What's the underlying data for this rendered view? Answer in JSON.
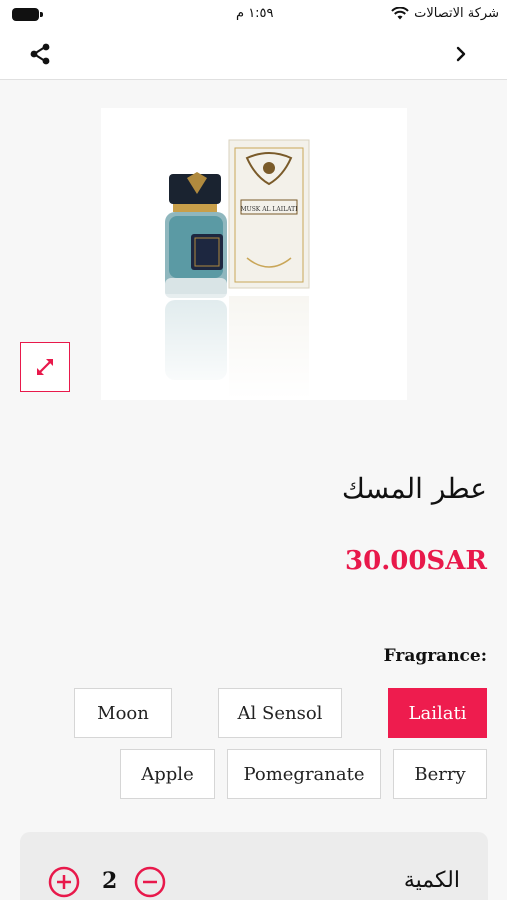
{
  "status_bar": {
    "carrier": "شركة الاتصالات",
    "time": "١:٥٩ م"
  },
  "product": {
    "title": "عطر المسك",
    "price": "30.00SAR",
    "box_label": "MUSK AL LAILATI"
  },
  "options": {
    "label": "Fragrance:",
    "choices": [
      "Lailati",
      "Al Sensol",
      "Moon",
      "Berry",
      "Pomegranate",
      "Apple"
    ],
    "selected": "Lailati"
  },
  "quantity": {
    "label": "الكمية",
    "value": "2"
  },
  "colors": {
    "accent": "#ee1c4e",
    "background": "#f7f7f7"
  },
  "icons": [
    "share-icon",
    "chevron-right-icon",
    "expand-icon",
    "plus-circle-icon",
    "minus-circle-icon",
    "wifi-icon",
    "battery-icon"
  ]
}
